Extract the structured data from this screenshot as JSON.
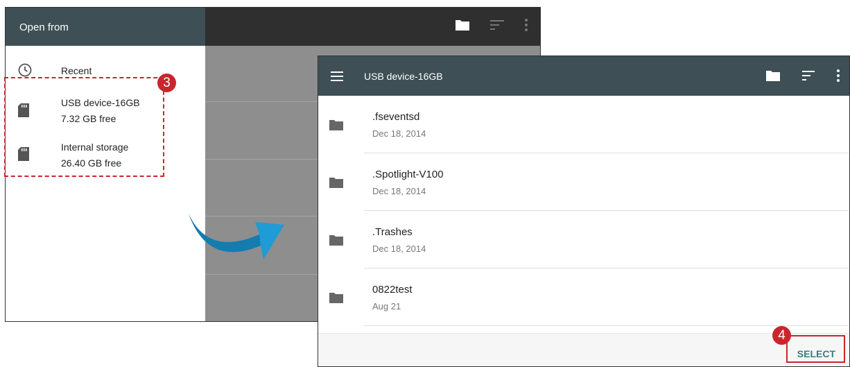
{
  "left": {
    "drawer_title": "Open from",
    "items": [
      {
        "icon": "clock-icon",
        "title": "Recent",
        "subtitle": ""
      },
      {
        "icon": "sd-card-icon",
        "title": "USB device-16GB",
        "subtitle": "7.32 GB free"
      },
      {
        "icon": "sd-card-icon",
        "title": "Internal storage",
        "subtitle": "26.40 GB free"
      }
    ],
    "toolbar_icons": [
      "folder-icon",
      "sort-icon",
      "more-vert-icon"
    ]
  },
  "right": {
    "toolbar_title": "USB device-16GB",
    "toolbar_icons": [
      "menu-icon",
      "folder-icon",
      "sort-icon",
      "more-vert-icon"
    ],
    "files": [
      {
        "name": ".fseventsd",
        "date": "Dec 18, 2014"
      },
      {
        "name": ".Spotlight-V100",
        "date": "Dec 18, 2014"
      },
      {
        "name": ".Trashes",
        "date": "Dec 18, 2014"
      },
      {
        "name": "0822test",
        "date": "Aug 21"
      }
    ],
    "select_label": "SELECT"
  },
  "annotations": {
    "step_3": "3",
    "step_4": "4"
  },
  "colors": {
    "toolbar": "#3e4f55",
    "highlight": "#c8262d",
    "accent": "#3a7d78",
    "arrow": "#1f9bd6"
  }
}
